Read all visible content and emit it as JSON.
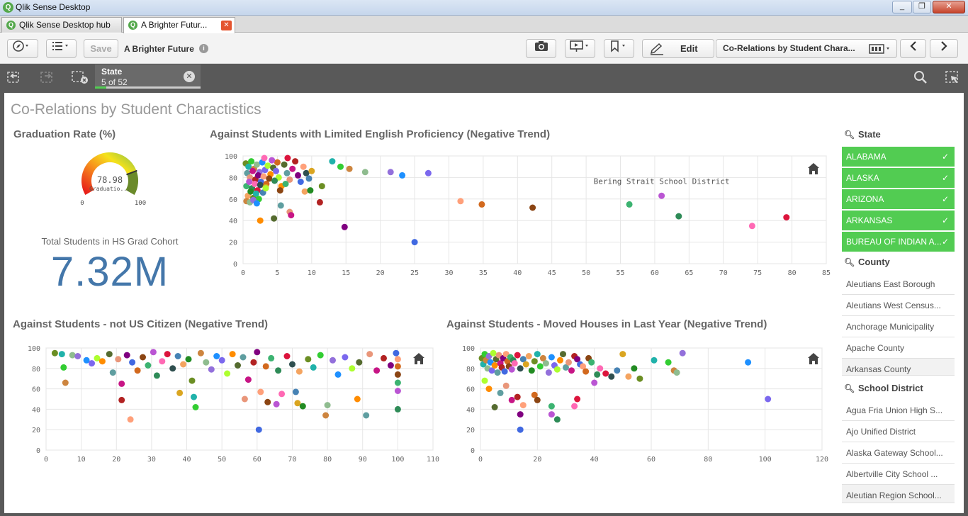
{
  "window": {
    "title": "Qlik Sense Desktop"
  },
  "tabs": [
    {
      "label": "Qlik Sense Desktop hub"
    },
    {
      "label": "A Brighter Futur..."
    }
  ],
  "toolbar": {
    "save_label": "Save",
    "app_name": "A Brighter Future",
    "edit_label": "Edit",
    "sheet_selector": "Co-Relations by Student Chara..."
  },
  "selections": {
    "field": "State",
    "count": "5 of 52"
  },
  "sheet": {
    "title": "Co-Relations by Student Charactistics"
  },
  "gauge": {
    "title": "Graduation Rate (%)",
    "value": 78.98,
    "value_label": "78.98",
    "sub_label": "Graduatio...",
    "min_label": "0",
    "max_label": "100"
  },
  "kpi": {
    "label": "Total Students in HS Grad Cohort",
    "value": "7.32M"
  },
  "chart_data": [
    {
      "type": "scatter",
      "title": "Against Students with Limited English Proficiency (Negative Trend)",
      "xlim": [
        0,
        85
      ],
      "ylim": [
        0,
        100
      ],
      "xticks": [
        0,
        5,
        10,
        15,
        20,
        25,
        30,
        35,
        40,
        45,
        50,
        55,
        60,
        65,
        70,
        75,
        80,
        85
      ],
      "yticks": [
        0,
        20,
        40,
        60,
        80,
        100
      ],
      "annotation": "Bering Strait School District",
      "points": [
        [
          0.4,
          93
        ],
        [
          0.8,
          90
        ],
        [
          1.2,
          95
        ],
        [
          1.6,
          88
        ],
        [
          2.0,
          92
        ],
        [
          2.4,
          85
        ],
        [
          2.8,
          94
        ],
        [
          3.2,
          87
        ],
        [
          3.6,
          91
        ],
        [
          4.0,
          83
        ],
        [
          4.4,
          89
        ],
        [
          0.6,
          84
        ],
        [
          1.0,
          80
        ],
        [
          1.4,
          86
        ],
        [
          1.8,
          78
        ],
        [
          2.2,
          82
        ],
        [
          2.6,
          76
        ],
        [
          3.0,
          81
        ],
        [
          3.4,
          74
        ],
        [
          3.8,
          79
        ],
        [
          0.5,
          72
        ],
        [
          0.9,
          76
        ],
        [
          1.3,
          70
        ],
        [
          1.7,
          74
        ],
        [
          2.1,
          68
        ],
        [
          2.5,
          73
        ],
        [
          2.9,
          66
        ],
        [
          3.3,
          71
        ],
        [
          0.7,
          63
        ],
        [
          1.1,
          67
        ],
        [
          1.5,
          61
        ],
        [
          1.9,
          65
        ],
        [
          2.3,
          60
        ],
        [
          0.5,
          58
        ],
        [
          1.0,
          57
        ],
        [
          1.5,
          59
        ],
        [
          2.0,
          56
        ],
        [
          4.8,
          86
        ],
        [
          5.2,
          80
        ],
        [
          5.6,
          72
        ],
        [
          6.0,
          92
        ],
        [
          6.4,
          84
        ],
        [
          6.8,
          78
        ],
        [
          7.2,
          88
        ],
        [
          7.6,
          95
        ],
        [
          8.0,
          82
        ],
        [
          8.4,
          76
        ],
        [
          8.8,
          90
        ],
        [
          5.0,
          94
        ],
        [
          5.4,
          68
        ],
        [
          6.2,
          74
        ],
        [
          4.2,
          96
        ],
        [
          4.6,
          77
        ],
        [
          3.1,
          98
        ],
        [
          6.5,
          98
        ],
        [
          9.2,
          84
        ],
        [
          9.6,
          79
        ],
        [
          10.0,
          86
        ],
        [
          9.0,
          67
        ],
        [
          9.8,
          68
        ],
        [
          11.5,
          72
        ],
        [
          13.0,
          95
        ],
        [
          14.2,
          90
        ],
        [
          15.5,
          88
        ],
        [
          17.8,
          85
        ],
        [
          21.5,
          85
        ],
        [
          23.2,
          82
        ],
        [
          27.0,
          84
        ],
        [
          3.3,
          70
        ],
        [
          2.5,
          40
        ],
        [
          4.5,
          42
        ],
        [
          5.5,
          54
        ],
        [
          6.8,
          48
        ],
        [
          7.0,
          45
        ],
        [
          11.2,
          57
        ],
        [
          14.8,
          34
        ],
        [
          25.0,
          20
        ],
        [
          31.7,
          58
        ],
        [
          34.8,
          55
        ],
        [
          42.2,
          52
        ],
        [
          56.3,
          55
        ],
        [
          61.0,
          63
        ],
        [
          63.5,
          44
        ],
        [
          74.2,
          35
        ],
        [
          79.2,
          43
        ]
      ]
    },
    {
      "type": "scatter",
      "title": "Against Students - not US Citizen (Negative Trend)",
      "xlim": [
        0,
        110
      ],
      "ylim": [
        0,
        100
      ],
      "xticks": [
        0,
        10,
        20,
        30,
        40,
        50,
        60,
        70,
        80,
        90,
        100,
        110
      ],
      "yticks": [
        0,
        20,
        40,
        60,
        80,
        100
      ],
      "points": [
        [
          2.5,
          95
        ],
        [
          4.5,
          94
        ],
        [
          5,
          81
        ],
        [
          5.5,
          66
        ],
        [
          7.5,
          93
        ],
        [
          9,
          92
        ],
        [
          11.5,
          88
        ],
        [
          13,
          85
        ],
        [
          14.5,
          90
        ],
        [
          16,
          87
        ],
        [
          18,
          94
        ],
        [
          19,
          76
        ],
        [
          20.5,
          89
        ],
        [
          21.5,
          65
        ],
        [
          21.5,
          49
        ],
        [
          23,
          93
        ],
        [
          24.5,
          86
        ],
        [
          24,
          30
        ],
        [
          26,
          78
        ],
        [
          27.5,
          91
        ],
        [
          29,
          83
        ],
        [
          30.5,
          96
        ],
        [
          31.5,
          73
        ],
        [
          33,
          87
        ],
        [
          34.5,
          94
        ],
        [
          36,
          80
        ],
        [
          37.5,
          92
        ],
        [
          38,
          56
        ],
        [
          39,
          84
        ],
        [
          40.5,
          89
        ],
        [
          41.5,
          68
        ],
        [
          42,
          52
        ],
        [
          42.5,
          42
        ],
        [
          44,
          95
        ],
        [
          45.5,
          86
        ],
        [
          47,
          79
        ],
        [
          48.5,
          92
        ],
        [
          50,
          88
        ],
        [
          51.5,
          75
        ],
        [
          53,
          94
        ],
        [
          54.5,
          83
        ],
        [
          56,
          91
        ],
        [
          56.5,
          50
        ],
        [
          57.5,
          69
        ],
        [
          59,
          86
        ],
        [
          60,
          96
        ],
        [
          60.5,
          20
        ],
        [
          61,
          57
        ],
        [
          62.5,
          82
        ],
        [
          63,
          47
        ],
        [
          64,
          90
        ],
        [
          65.5,
          45
        ],
        [
          66,
          78
        ],
        [
          67,
          55
        ],
        [
          68.5,
          92
        ],
        [
          70,
          84
        ],
        [
          71,
          57
        ],
        [
          71.5,
          46
        ],
        [
          72,
          77
        ],
        [
          73,
          43
        ],
        [
          74.5,
          89
        ],
        [
          76,
          81
        ],
        [
          78,
          93
        ],
        [
          79.5,
          34
        ],
        [
          80,
          44
        ],
        [
          81.5,
          88
        ],
        [
          83,
          74
        ],
        [
          85,
          91
        ],
        [
          87,
          80
        ],
        [
          88.5,
          50
        ],
        [
          89,
          86
        ],
        [
          91,
          34
        ],
        [
          92,
          94
        ],
        [
          94,
          78
        ],
        [
          96,
          90
        ],
        [
          98,
          83
        ],
        [
          99.5,
          95
        ],
        [
          100,
          89
        ],
        [
          100,
          82
        ],
        [
          100,
          74
        ],
        [
          100,
          66
        ],
        [
          100,
          58
        ],
        [
          100,
          40
        ]
      ]
    },
    {
      "type": "scatter",
      "title": "Against Students - Moved Houses in Last Year (Negative Trend)",
      "xlim": [
        0,
        120
      ],
      "ylim": [
        0,
        100
      ],
      "xticks": [
        0,
        20,
        40,
        60,
        80,
        100,
        120
      ],
      "yticks": [
        0,
        20,
        40,
        60,
        80,
        100
      ],
      "points": [
        [
          0.5,
          90
        ],
        [
          1,
          84
        ],
        [
          1.5,
          94
        ],
        [
          2,
          88
        ],
        [
          2.5,
          80
        ],
        [
          3,
          92
        ],
        [
          3.5,
          86
        ],
        [
          4,
          78
        ],
        [
          4.5,
          95
        ],
        [
          5,
          83
        ],
        [
          5.5,
          89
        ],
        [
          6,
          76
        ],
        [
          6.5,
          93
        ],
        [
          7,
          85
        ],
        [
          7.5,
          81
        ],
        [
          8,
          90
        ],
        [
          8.5,
          77
        ],
        [
          9,
          94
        ],
        [
          9.5,
          87
        ],
        [
          10,
          82
        ],
        [
          10.5,
          91
        ],
        [
          11,
          79
        ],
        [
          11.5,
          88
        ],
        [
          12,
          85
        ],
        [
          13,
          93
        ],
        [
          14,
          80
        ],
        [
          15,
          89
        ],
        [
          16,
          84
        ],
        [
          17,
          92
        ],
        [
          18,
          78
        ],
        [
          19,
          87
        ],
        [
          20,
          94
        ],
        [
          21,
          82
        ],
        [
          22,
          90
        ],
        [
          23,
          85
        ],
        [
          24,
          76
        ],
        [
          25,
          91
        ],
        [
          26,
          83
        ],
        [
          27,
          79
        ],
        [
          28,
          88
        ],
        [
          29,
          94
        ],
        [
          30,
          81
        ],
        [
          31,
          86
        ],
        [
          32,
          78
        ],
        [
          33,
          92
        ],
        [
          34,
          89
        ],
        [
          35,
          84
        ],
        [
          36,
          82
        ],
        [
          37,
          77
        ],
        [
          38,
          90
        ],
        [
          39,
          86
        ],
        [
          40,
          66
        ],
        [
          41,
          74
        ],
        [
          42,
          80
        ],
        [
          44,
          75
        ],
        [
          46,
          72
        ],
        [
          48,
          78
        ],
        [
          50,
          94
        ],
        [
          52,
          72
        ],
        [
          54,
          80
        ],
        [
          56,
          70
        ],
        [
          61,
          88
        ],
        [
          66,
          86
        ],
        [
          68,
          78
        ],
        [
          69,
          76
        ],
        [
          71,
          95
        ],
        [
          94,
          86
        ],
        [
          101,
          50
        ],
        [
          1.5,
          68
        ],
        [
          3,
          60
        ],
        [
          5,
          42
        ],
        [
          7,
          56
        ],
        [
          9,
          63
        ],
        [
          11,
          49
        ],
        [
          13,
          52
        ],
        [
          14,
          35
        ],
        [
          14,
          20
        ],
        [
          15,
          44
        ],
        [
          19,
          54
        ],
        [
          20,
          49
        ],
        [
          25,
          43
        ],
        [
          25,
          35
        ],
        [
          27,
          30
        ],
        [
          33,
          43
        ],
        [
          34,
          50
        ]
      ]
    }
  ],
  "filters": {
    "state": {
      "label": "State",
      "selected": [
        "ALABAMA",
        "ALASKA",
        "ARIZONA",
        "ARKANSAS",
        "BUREAU OF INDIAN A..."
      ]
    },
    "county": {
      "label": "County",
      "items": [
        "Aleutians East Borough",
        "Aleutians West Census...",
        "Anchorage Municipality",
        "Apache County",
        "Arkansas County"
      ]
    },
    "district": {
      "label": "School District",
      "items": [
        "Agua Fria Union High S...",
        "Ajo Unified District",
        "Alaska Gateway School...",
        "Albertville City School ...",
        "Aleutian Region School..."
      ]
    }
  }
}
